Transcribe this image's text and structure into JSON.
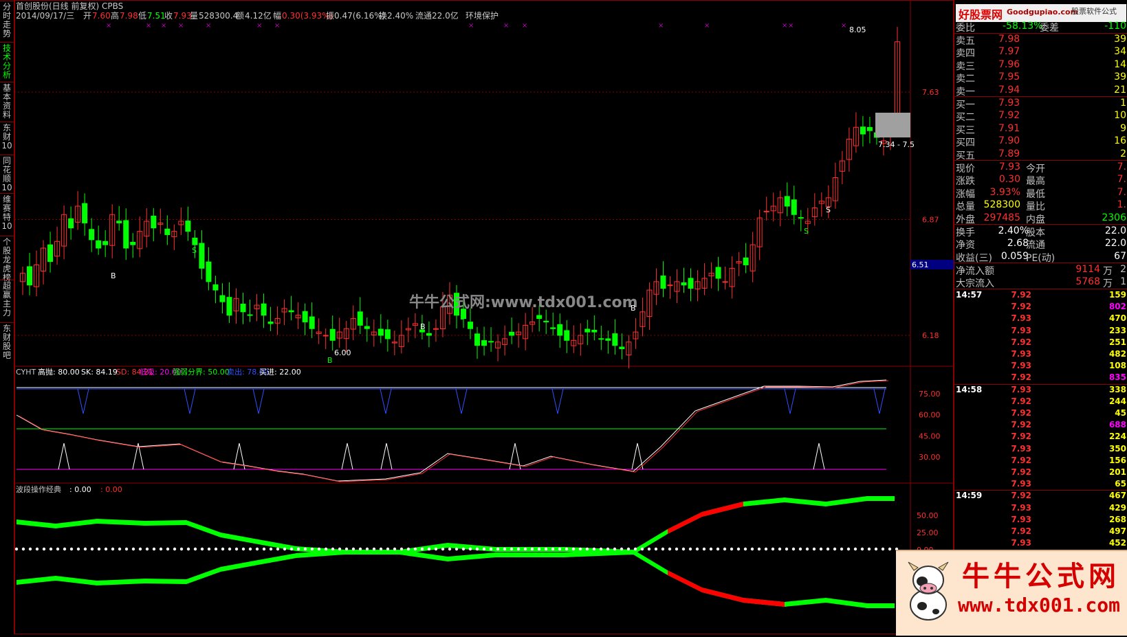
{
  "side_tabs": [
    "分时走势",
    "技术分析",
    "基本资料",
    "东财10",
    "同花顺10",
    "维赛特10",
    "个股龙虎榜",
    "超赢主力",
    "东财股吧"
  ],
  "header": {
    "title_line": "首创股份(日线 前复权) CPBS",
    "date": "2014/09/17/三",
    "open_label": "开",
    "open": "7.60",
    "high_label": "高",
    "high": "7.98",
    "low_label": "低",
    "low": "7.51",
    "close_label": "收",
    "close": "7.93",
    "vol_label": "量",
    "vol": "528300.4",
    "amt_label": "额",
    "amt": "4.12亿",
    "chg_label": "幅",
    "chg": "0.30(3.93%)",
    "amp": "振0.47(6.16%)",
    "turn": "换2.40%",
    "float": "流通22.0亿",
    "concept": "环境保护"
  },
  "main_chart": {
    "price_labels": [
      "7.63",
      "6.87",
      "6.18"
    ],
    "current_price_tag": "6.51",
    "high_annot": "8.05",
    "low_annot": "6.00",
    "box_annot": "7.34 - 7.5",
    "watermark": "牛牛公式网:www.tdx001.com",
    "markers": [
      "B",
      "S",
      "B",
      "S",
      "B",
      "S",
      "S",
      "B"
    ]
  },
  "ind1": {
    "name": "CYHT",
    "items": [
      {
        "label": "高抛: 80.00",
        "color": "#ffffff"
      },
      {
        "label": "SK: 84.19",
        "color": "#ffffff"
      },
      {
        "label": "SD: 84.21",
        "color": "#ff3030"
      },
      {
        "label": "低吸: 20.00",
        "color": "#ff00ff"
      },
      {
        "label": "强弱分界: 50.00",
        "color": "#00ff00"
      },
      {
        "label": "卖出: 78.00",
        "color": "#3050ff"
      },
      {
        "label": "买进: 22.00",
        "color": "#ffffff"
      }
    ],
    "axis": [
      "75.00",
      "60.00",
      "45.00",
      "30.00"
    ]
  },
  "ind2": {
    "name": "波段操作经典",
    "v1": ": 0.00",
    "v2": ": 0.00",
    "axis": [
      "50.00",
      "25.00",
      "0.00"
    ]
  },
  "orderbook": {
    "logo": "好股票网",
    "logo_sub": "Goodgupiao.com",
    "logo_right": "股票软件公式",
    "weibi_label": "委比",
    "weibi": "-58.13%",
    "weicha_label": "委差",
    "weicha": "-110",
    "asks": [
      {
        "label": "卖五",
        "price": "7.98",
        "vol": "39"
      },
      {
        "label": "卖四",
        "price": "7.97",
        "vol": "34"
      },
      {
        "label": "卖三",
        "price": "7.96",
        "vol": "14"
      },
      {
        "label": "卖二",
        "price": "7.95",
        "vol": "39"
      },
      {
        "label": "卖一",
        "price": "7.94",
        "vol": "21"
      }
    ],
    "bids": [
      {
        "label": "买一",
        "price": "7.93",
        "vol": "1"
      },
      {
        "label": "买二",
        "price": "7.92",
        "vol": "10"
      },
      {
        "label": "买三",
        "price": "7.91",
        "vol": "9"
      },
      {
        "label": "买四",
        "price": "7.90",
        "vol": "16"
      },
      {
        "label": "买五",
        "price": "7.89",
        "vol": "2"
      }
    ],
    "stats": [
      {
        "l1": "现价",
        "v1": "7.93",
        "c1": "#ff3030",
        "l2": "今开",
        "v2": "7."
      },
      {
        "l1": "涨跌",
        "v1": "0.30",
        "c1": "#ff3030",
        "l2": "最高",
        "v2": "7."
      },
      {
        "l1": "涨幅",
        "v1": "3.93%",
        "c1": "#ff3030",
        "l2": "最低",
        "v2": "7."
      },
      {
        "l1": "总量",
        "v1": "528300",
        "c1": "#ffff00",
        "l2": "量比",
        "v2": "1."
      },
      {
        "l1": "外盘",
        "v1": "297485",
        "c1": "#ff3030",
        "l2": "内盘",
        "v2": "2306"
      }
    ],
    "stats2": [
      {
        "l1": "换手",
        "v1": "2.40%",
        "l2": "股本",
        "v2": "22.0"
      },
      {
        "l1": "净资",
        "v1": "2.68",
        "l2": "流通",
        "v2": "22.0"
      },
      {
        "l1": "收益(三)",
        "v1": "0.059",
        "l2": "PE(动)",
        "v2": "67"
      }
    ],
    "flow": [
      {
        "label": "净流入额",
        "value": "9114",
        "unit": "万",
        "tail": "2"
      },
      {
        "label": "大宗流入",
        "value": "5768",
        "unit": "万",
        "tail": "1"
      }
    ]
  },
  "ticks": [
    {
      "time": "14:57",
      "rows": [
        [
          "7.92",
          "159",
          "#ffff00"
        ],
        [
          "7.92",
          "802",
          "#ff00ff"
        ],
        [
          "7.93",
          "470",
          "#ffff00"
        ],
        [
          "7.93",
          "233",
          "#ffff00"
        ],
        [
          "7.92",
          "251",
          "#ffff00"
        ],
        [
          "7.93",
          "482",
          "#ffff00"
        ],
        [
          "7.93",
          "108",
          "#ffff00"
        ],
        [
          "7.92",
          "835",
          "#ff00ff"
        ]
      ]
    },
    {
      "time": "14:58",
      "rows": [
        [
          "7.93",
          "338",
          "#ffff00"
        ],
        [
          "7.92",
          "244",
          "#ffff00"
        ],
        [
          "7.92",
          "45",
          "#ffff00"
        ],
        [
          "7.92",
          "688",
          "#ff00ff"
        ],
        [
          "7.92",
          "224",
          "#ffff00"
        ],
        [
          "7.93",
          "350",
          "#ffff00"
        ],
        [
          "7.92",
          "156",
          "#ffff00"
        ],
        [
          "7.92",
          "201",
          "#ffff00"
        ],
        [
          "7.93",
          "65",
          "#ffff00"
        ]
      ]
    },
    {
      "time": "14:59",
      "rows": [
        [
          "7.92",
          "467",
          "#ffff00"
        ],
        [
          "7.93",
          "429",
          "#ffff00"
        ],
        [
          "7.93",
          "268",
          "#ffff00"
        ],
        [
          "7.92",
          "497",
          "#ffff00"
        ],
        [
          "7.93",
          "452",
          "#ffff00"
        ]
      ]
    }
  ],
  "promo": {
    "title": "牛牛公式网",
    "url": "www.tdx001.com"
  }
}
